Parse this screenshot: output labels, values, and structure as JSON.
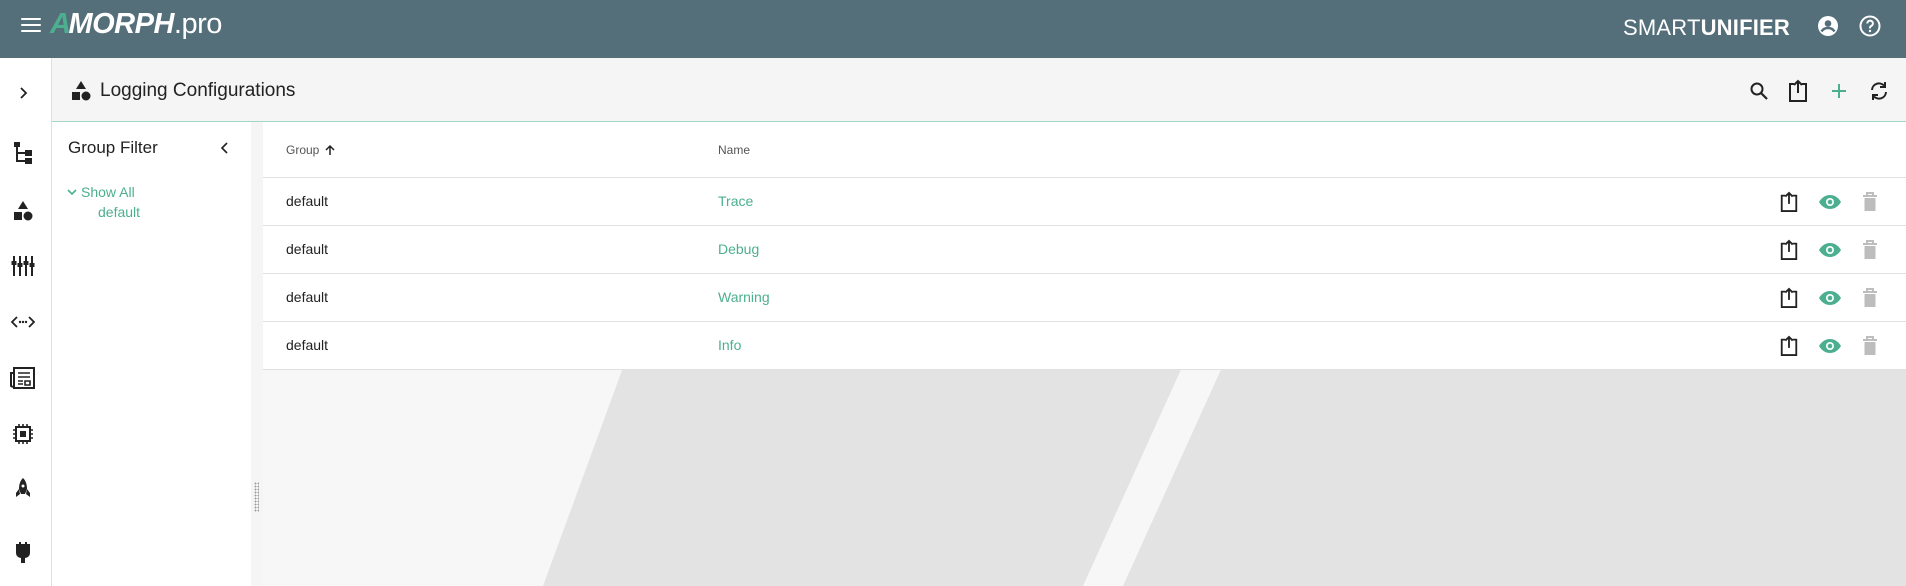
{
  "topbar": {
    "logo_accent": "A",
    "logo_brand": "MORPH",
    "logo_suffix": ".pro",
    "product_light": "SMART",
    "product_bold": "UNIFIER",
    "icons": [
      "menu-icon",
      "account-circle-icon",
      "help-icon"
    ]
  },
  "rail": {
    "items": [
      {
        "name": "expand-icon"
      },
      {
        "name": "hierarchy-icon"
      },
      {
        "name": "shapes-icon"
      },
      {
        "name": "equalizer-icon"
      },
      {
        "name": "code-arrows-icon"
      },
      {
        "name": "newspaper-icon"
      },
      {
        "name": "chip-icon"
      },
      {
        "name": "rocket-icon"
      },
      {
        "name": "plug-icon"
      }
    ]
  },
  "page": {
    "title": "Logging Configurations",
    "actions": [
      "search-icon",
      "export-icon",
      "add-icon",
      "refresh-icon"
    ]
  },
  "filter": {
    "title": "Group Filter",
    "root_label": "Show All",
    "child_label": "default"
  },
  "table": {
    "columns": {
      "group": "Group",
      "name": "Name"
    },
    "sort": {
      "column": "Group",
      "direction": "ascending"
    },
    "rows": [
      {
        "group": "default",
        "name": "Trace"
      },
      {
        "group": "default",
        "name": "Debug"
      },
      {
        "group": "default",
        "name": "Warning"
      },
      {
        "group": "default",
        "name": "Info"
      }
    ],
    "row_actions": [
      "export-icon",
      "view-icon",
      "delete-icon"
    ]
  },
  "colors": {
    "topbar": "#546e7a",
    "accent": "#4caf8f",
    "disabled": "#bdbdbd"
  }
}
